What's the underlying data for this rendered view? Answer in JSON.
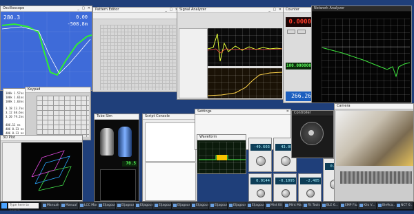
{
  "scope_top_left": {
    "reading_a": "280.3",
    "reading_b": "0.00",
    "reading_c": "-508.8m"
  },
  "meas_list": {
    "lines": [
      "100k 1.57ns",
      "100k 1.61ns",
      "100k 1.63ns",
      "3.18 23.7ns",
      "3.12 68.6ns",
      "3.20 79.2ns",
      "406.11 ns",
      "406 8.23 ns",
      "406 8.23 ns"
    ]
  },
  "tuning_meter": {
    "value": "70.5"
  },
  "counter_red": {
    "value": "0.0000"
  },
  "freq_green": {
    "value": "100.000000"
  },
  "digital_meter": {
    "value": "266.26"
  },
  "bottom_meters": {
    "m1": "-49.603",
    "m2": "43.003",
    "m3": "0.0144",
    "m4": "-0.1095",
    "m5": "-2.405",
    "m6": "0.000"
  },
  "taskbar": {
    "search_placeholder": "Type here to search",
    "items": [
      "Manuals",
      "Manual T...",
      "LCC Manual...",
      "Eljagoun1...",
      "Eljagoun2...",
      "Eljagoun3...",
      "Eljagoun4...",
      "Eljagoun5...",
      "Eljagoun6...",
      "Eljagoun7...",
      "Eljagoun8...",
      "Eljagoun9...",
      "Mint Kit",
      "Mint Manager",
      "Fit Tools",
      "BLE 6...",
      "EMP Flux Li...",
      "Kilo V...",
      "Ble9ca...",
      "NCT 6..."
    ]
  }
}
